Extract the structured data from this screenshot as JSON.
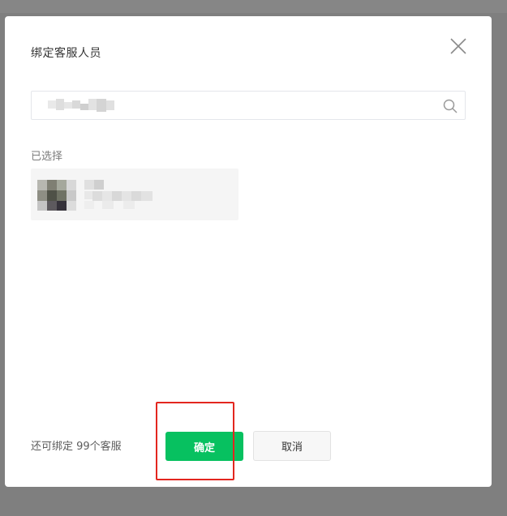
{
  "dialog": {
    "title": "绑定客服人员",
    "close_icon": "close-icon"
  },
  "search": {
    "value": "",
    "icon": "search-icon"
  },
  "selected": {
    "label": "已选择"
  },
  "footer": {
    "note": "还可绑定 99个客服",
    "confirm_label": "确定",
    "cancel_label": "取消"
  },
  "colors": {
    "primary": "#07c160",
    "annotation": "#e3261f"
  }
}
